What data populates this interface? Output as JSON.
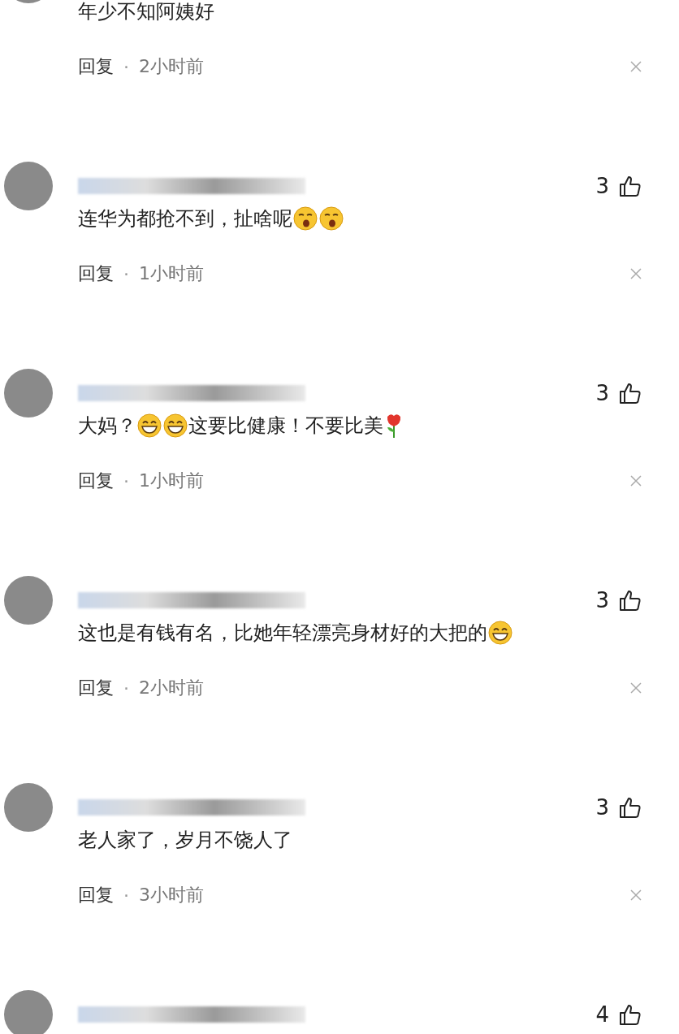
{
  "comments": [
    {
      "kind": "partial",
      "body": [
        {
          "kind": "text",
          "text": "年少不知阿姨好"
        }
      ],
      "reply": "回复",
      "separator": "·",
      "time": "2小时前"
    },
    {
      "kind": "full",
      "likes": "3",
      "body": [
        {
          "kind": "text",
          "text": "连华为都抢不到，扯啥呢"
        },
        {
          "kind": "yawn-emoji"
        },
        {
          "kind": "yawn-emoji"
        }
      ],
      "reply": "回复",
      "separator": "·",
      "time": "1小时前"
    },
    {
      "kind": "full",
      "likes": "3",
      "body": [
        {
          "kind": "text",
          "text": "大妈？"
        },
        {
          "kind": "grin-emoji"
        },
        {
          "kind": "grin-emoji"
        },
        {
          "kind": "text",
          "text": "这要比健康！不要比美"
        },
        {
          "kind": "rose-emoji"
        }
      ],
      "reply": "回复",
      "separator": "·",
      "time": "1小时前"
    },
    {
      "kind": "full",
      "likes": "3",
      "body": [
        {
          "kind": "text",
          "text": "这也是有钱有名，比她年轻漂亮身材好的大把的"
        },
        {
          "kind": "grin-emoji"
        }
      ],
      "reply": "回复",
      "separator": "·",
      "time": "2小时前"
    },
    {
      "kind": "full",
      "likes": "3",
      "body": [
        {
          "kind": "text",
          "text": "老人家了，岁月不饶人了"
        }
      ],
      "reply": "回复",
      "separator": "·",
      "time": "3小时前"
    },
    {
      "kind": "header-only",
      "likes": "4"
    }
  ]
}
